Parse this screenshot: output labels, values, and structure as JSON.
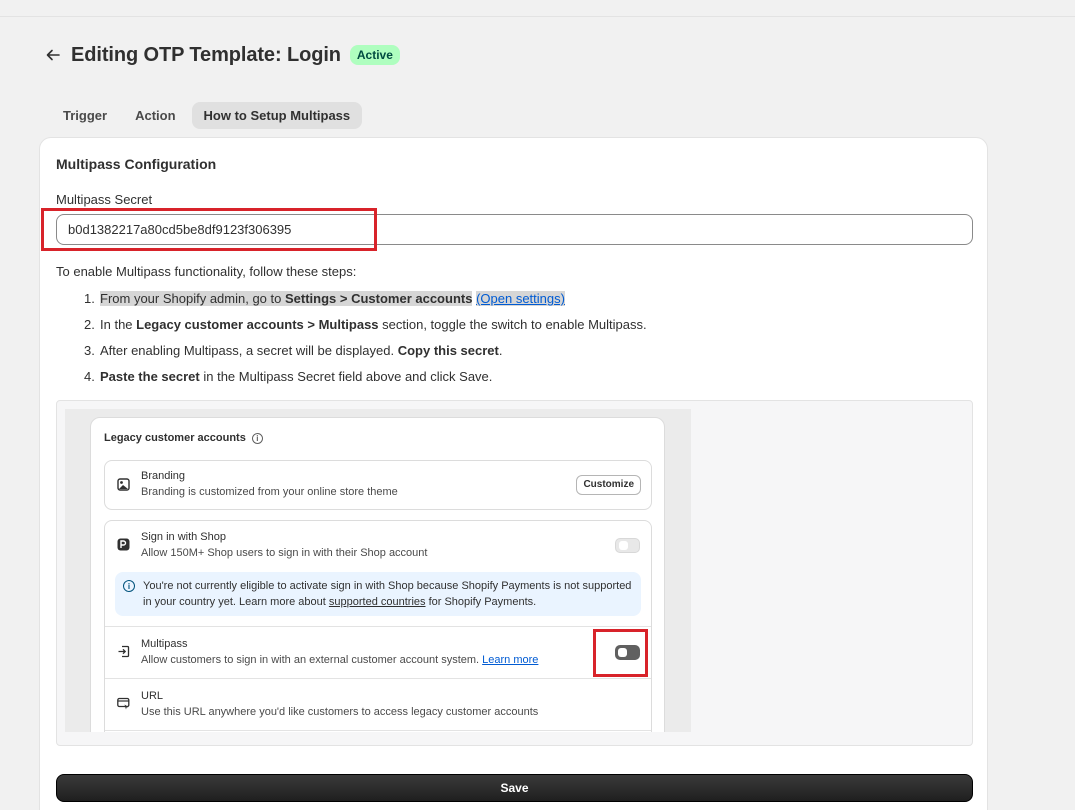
{
  "header": {
    "title": "Editing OTP Template: Login",
    "status_badge": "Active"
  },
  "tabs": [
    {
      "label": "Trigger",
      "active": false
    },
    {
      "label": "Action",
      "active": false
    },
    {
      "label": "How to Setup Multipass",
      "active": true
    }
  ],
  "card": {
    "title": "Multipass Configuration",
    "secret_label": "Multipass Secret",
    "secret_value": "b0d1382217a80cd5be8df9123f306395",
    "intro": "To enable Multipass functionality, follow these steps:",
    "steps": {
      "s1": {
        "num": "1.",
        "a": "From your Shopify admin, go to ",
        "b": "Settings > Customer accounts",
        "link": "(Open settings)"
      },
      "s2": {
        "num": "2.",
        "a": "In the ",
        "b": "Legacy customer accounts > Multipass",
        "c": " section, toggle the switch to enable Multipass."
      },
      "s3": {
        "num": "3.",
        "a": "After enabling Multipass, a secret will be displayed. ",
        "b": "Copy this secret",
        "c": "."
      },
      "s4": {
        "num": "4.",
        "b": "Paste the secret",
        "c": " in the Multipass Secret field above and click Save."
      }
    },
    "save_label": "Save"
  },
  "preview": {
    "title": "Legacy customer accounts",
    "branding": {
      "title": "Branding",
      "sub": "Branding is customized from your online store theme",
      "button": "Customize"
    },
    "shop": {
      "title": "Sign in with Shop",
      "sub": "Allow 150M+ Shop users to sign in with their Shop account"
    },
    "notice": {
      "a": "You're not currently eligible to activate sign in with Shop because Shopify Payments is not supported in your country yet. Learn more about ",
      "link": "supported countries",
      "c": " for Shopify Payments."
    },
    "multipass": {
      "title": "Multipass",
      "sub": "Allow customers to sign in with an external customer account system. ",
      "link": "Learn more"
    },
    "url": {
      "title": "URL",
      "sub": "Use this URL anywhere you'd like customers to access legacy customer accounts"
    }
  },
  "colors": {
    "accent_red": "#d8232a",
    "badge_bg": "#affebf",
    "link": "#005bd3"
  }
}
